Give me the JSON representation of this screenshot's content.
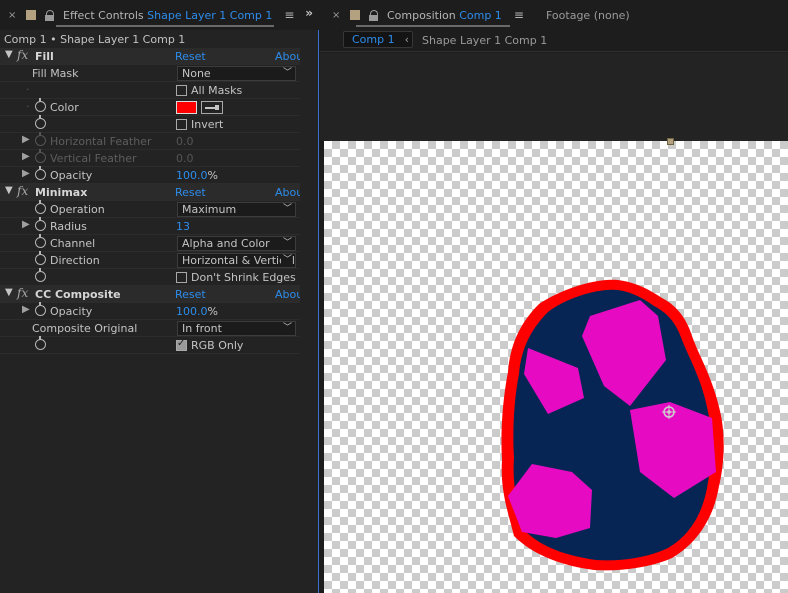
{
  "left_panel": {
    "tab": {
      "close": "×",
      "prefix": "Effect Controls",
      "layer": "Shape Layer 1 Comp 1",
      "menu": "≡",
      "overflow": "»"
    },
    "breadcrumb": "Comp 1 • Shape Layer 1 Comp 1",
    "effects": {
      "fill": {
        "name": "Fill",
        "reset": "Reset",
        "about": "About",
        "fill_mask_label": "Fill Mask",
        "fill_mask_value": "None",
        "all_masks_label": "All Masks",
        "all_masks_checked": false,
        "color_label": "Color",
        "color_value": "#ff0000",
        "invert_label": "Invert",
        "invert_checked": false,
        "horizontal_feather_label": "Horizontal Feather",
        "horizontal_feather_value": "0.0",
        "vertical_feather_label": "Vertical Feather",
        "vertical_feather_value": "0.0",
        "opacity_label": "Opacity",
        "opacity_value": "100.0",
        "opacity_unit": "%"
      },
      "minimax": {
        "name": "Minimax",
        "reset": "Reset",
        "about": "About",
        "operation_label": "Operation",
        "operation_value": "Maximum",
        "radius_label": "Radius",
        "radius_value": "13",
        "channel_label": "Channel",
        "channel_value": "Alpha and Color",
        "direction_label": "Direction",
        "direction_value": "Horizontal & Vertical",
        "dont_shrink_label": "Don't Shrink Edges",
        "dont_shrink_checked": false
      },
      "cc_composite": {
        "name": "CC Composite",
        "reset": "Reset",
        "about": "About",
        "opacity_label": "Opacity",
        "opacity_value": "100.0",
        "opacity_unit": "%",
        "composite_original_label": "Composite Original",
        "composite_original_value": "In front",
        "rgb_only_label": "RGB Only",
        "rgb_only_checked": true
      }
    }
  },
  "right_panel": {
    "tab": {
      "close": "×",
      "prefix": "Composition",
      "comp": "Comp 1",
      "menu": "≡"
    },
    "footage_tab": "Footage (none)",
    "comp_button": "Comp 1",
    "sub_path": "Shape Layer 1 Comp 1"
  },
  "colors": {
    "accent": "#2d8ceb",
    "egg_fill": "#062554",
    "egg_stroke": "#ff0000",
    "spots": "#e60ac2"
  }
}
